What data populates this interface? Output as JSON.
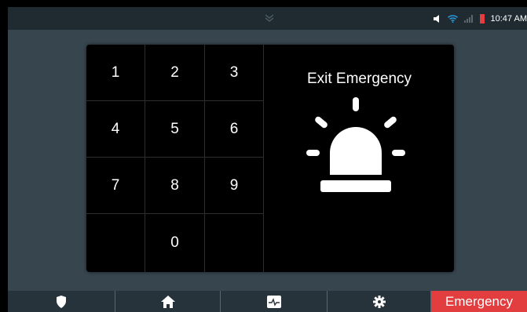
{
  "status_bar": {
    "time": "10:47 AM"
  },
  "keypad": {
    "keys": [
      "1",
      "2",
      "3",
      "4",
      "5",
      "6",
      "7",
      "8",
      "9",
      "",
      "0",
      ""
    ]
  },
  "exit_panel": {
    "title": "Exit Emergency",
    "icon": "siren-icon"
  },
  "nav": {
    "items": [
      {
        "icon": "shield-icon"
      },
      {
        "icon": "home-icon"
      },
      {
        "icon": "activity-icon"
      },
      {
        "icon": "gear-icon"
      }
    ],
    "emergency_label": "Emergency"
  },
  "colors": {
    "background": "#37454f",
    "panel": "#000000",
    "emergency": "#e23d3f",
    "battery": "#e23d3f"
  }
}
